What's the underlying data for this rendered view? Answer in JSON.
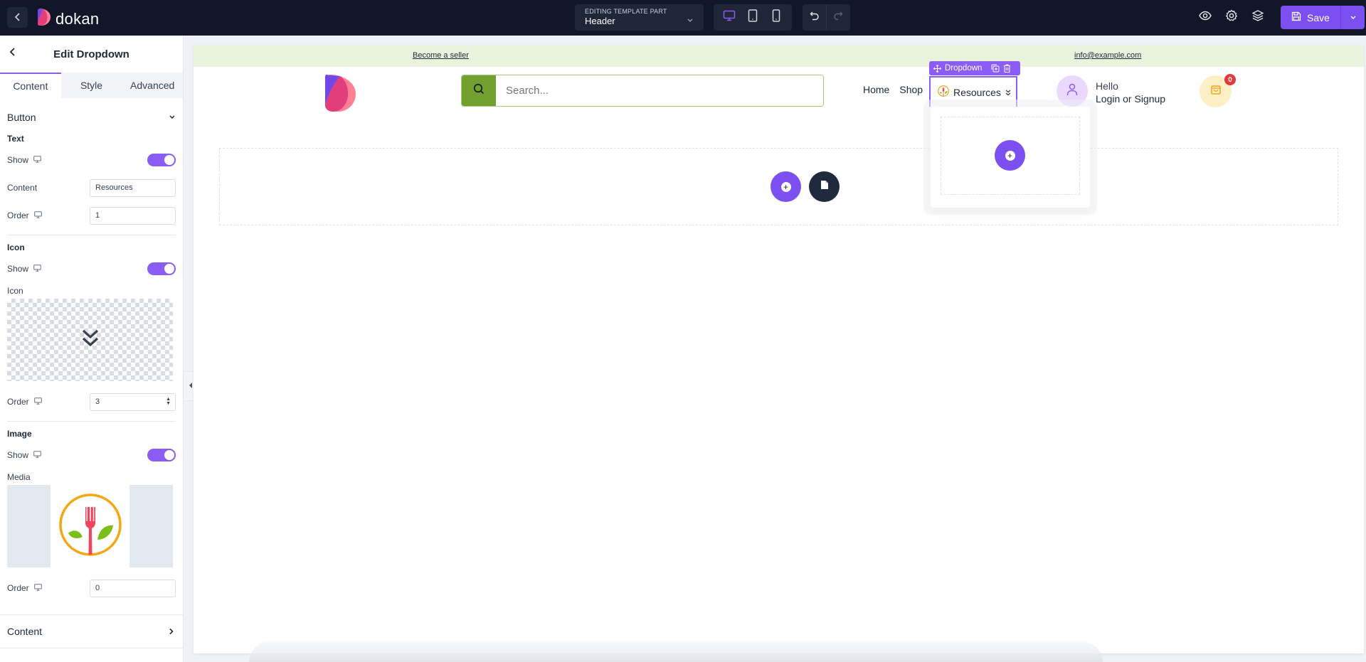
{
  "topbar": {
    "brand": "dokan",
    "template_part": {
      "label": "EDITING TEMPLATE PART",
      "value": "Header"
    },
    "devices": [
      {
        "name": "desktop",
        "active": true
      },
      {
        "name": "tablet",
        "active": false
      },
      {
        "name": "mobile",
        "active": false
      }
    ],
    "save_label": "Save",
    "icons": [
      "back-icon",
      "preview-eye-icon",
      "settings-gear-icon",
      "layers-icon",
      "undo-icon",
      "redo-icon",
      "save-disk-icon",
      "chevron-down-icon"
    ]
  },
  "sidebar": {
    "title": "Edit Dropdown",
    "tabs": [
      {
        "label": "Content",
        "active": true
      },
      {
        "label": "Style",
        "active": false
      },
      {
        "label": "Advanced",
        "active": false
      }
    ],
    "button_section": {
      "title": "Button",
      "text_group": {
        "title": "Text",
        "show_label": "Show",
        "show_on": true,
        "content_label": "Content",
        "content_value": "Resources",
        "order_label": "Order",
        "order_value": "1"
      },
      "icon_group": {
        "title": "Icon",
        "show_label": "Show",
        "show_on": true,
        "icon_label": "Icon",
        "icon_value": "double-chevron-down-icon",
        "order_label": "Order",
        "order_value": "3"
      },
      "image_group": {
        "title": "Image",
        "show_label": "Show",
        "show_on": true,
        "media_label": "Media",
        "media_value": "fork-leaf-logo",
        "order_label": "Order",
        "order_value": "0"
      }
    },
    "content_section": {
      "title": "Content"
    }
  },
  "canvas": {
    "topstrip": {
      "left_link": "Become a seller",
      "right_link": "info@example.com",
      "bg_color": "#e9f3de"
    },
    "search": {
      "placeholder": "Search...",
      "button_color": "#72a02e"
    },
    "nav": [
      "Home",
      "Shop"
    ],
    "dropdown": {
      "toolbar_label": "Dropdown",
      "button_text": "Resources"
    },
    "user": {
      "line1": "Hello",
      "line2": "Login or Signup"
    },
    "cart": {
      "count": "0"
    },
    "accent_color": "#7b4ff0"
  }
}
